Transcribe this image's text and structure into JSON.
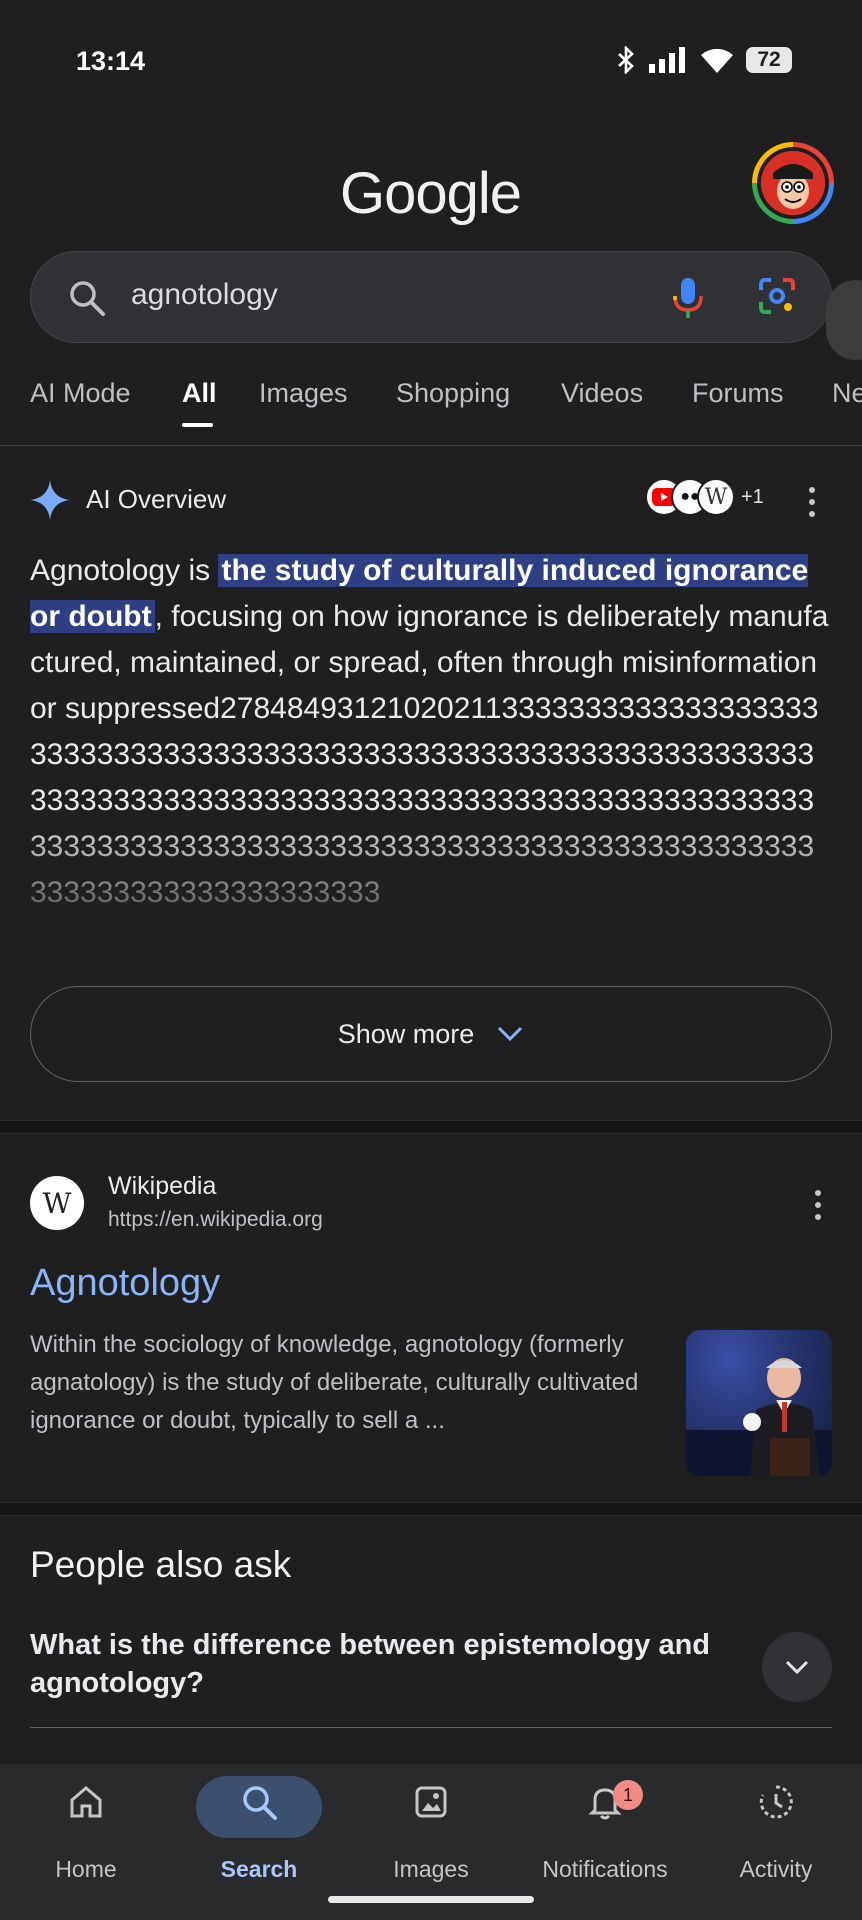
{
  "status_bar": {
    "time": "13:14",
    "battery": "72"
  },
  "header": {
    "logo": "Google"
  },
  "search": {
    "query": "agnotology"
  },
  "tabs": [
    "AI Mode",
    "All",
    "Images",
    "Shopping",
    "Videos",
    "Forums",
    "Ne"
  ],
  "active_tab": "All",
  "ai_overview": {
    "title": "AI Overview",
    "sources_extra": "+1",
    "text_before": "Agnotology is ",
    "highlight": "the study of culturally induced ignorance or doubt",
    "text_after": ", focusing on how ignorance is deliberately manufactured, maintained, or spread, often through misinformation or suppressed278484931210202113333333333333333333333333333333333333333333333333333333333333333333333333333333333333333333333333333333333333333333333333333333333333333333333333333333333333333333333333333333333333",
    "show_more": "Show more"
  },
  "result": {
    "site": "Wikipedia",
    "url": "https://en.wikipedia.org",
    "favicon": "W",
    "title": "Agnotology",
    "snippet": "Within the sociology of knowledge, agnotology (formerly agnatology) is the study of deliberate, culturally cultivated ignorance or doubt, typically to sell a ..."
  },
  "people_also_ask": {
    "title": "People also ask",
    "questions": [
      "What is the difference between epistemology and agnotology?"
    ]
  },
  "bottom_nav": {
    "items": [
      {
        "label": "Home",
        "icon": "home-icon"
      },
      {
        "label": "Search",
        "icon": "search-icon"
      },
      {
        "label": "Images",
        "icon": "images-icon"
      },
      {
        "label": "Notifications",
        "icon": "bell-icon",
        "badge": "1"
      },
      {
        "label": "Activity",
        "icon": "activity-icon"
      }
    ],
    "active": "Search"
  },
  "colors": {
    "link": "#8ab4f8",
    "highlight_bg": "#2f3f83",
    "nav_active": "#a8c7fa"
  }
}
